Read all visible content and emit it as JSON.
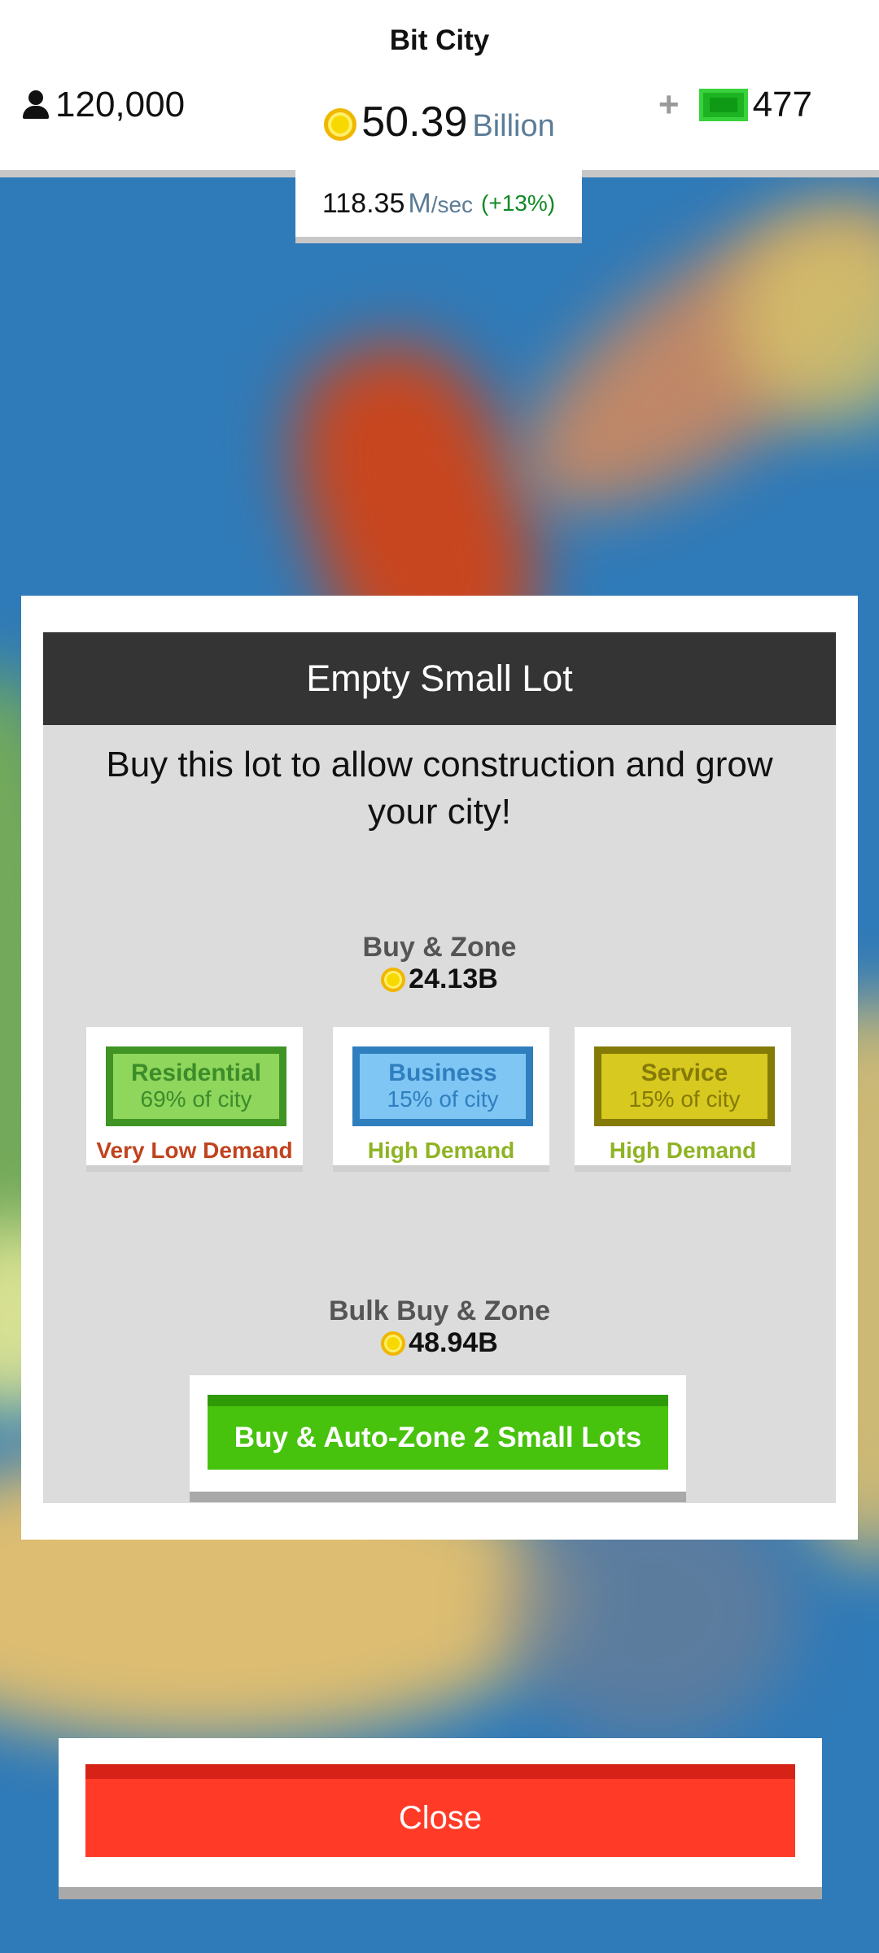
{
  "app": {
    "title": "Bit City"
  },
  "header": {
    "population": "120,000",
    "money_value": "50.39",
    "money_unit": "Billion",
    "rate_value": "118.35",
    "rate_unit": "M",
    "rate_suffix": "/sec",
    "rate_change": "(+13%)",
    "cash_plus": "+",
    "cash": "477"
  },
  "dialog": {
    "title": "Empty Small Lot",
    "description": "Buy this lot to allow construction and grow your city!",
    "buy_zone_label": "Buy & Zone",
    "buy_zone_price": "24.13B",
    "zones": [
      {
        "name": "Residential",
        "share": "69% of city",
        "demand": "Very Low Demand"
      },
      {
        "name": "Business",
        "share": "15% of city",
        "demand": "High Demand"
      },
      {
        "name": "Service",
        "share": "15% of city",
        "demand": "High Demand"
      }
    ],
    "bulk_label": "Bulk Buy & Zone",
    "bulk_price": "48.94B",
    "bulk_button": "Buy & Auto-Zone 2 Small Lots"
  },
  "close_button": "Close",
  "colors": {
    "header_bg": "#ffffff",
    "dialog_title_bg": "#343434",
    "residential": "#8ed65c",
    "business": "#7fc6f5",
    "service": "#d7c91f",
    "low_demand": "#c0431e",
    "high_demand": "#8fb324",
    "buy_button": "#47c20d",
    "close_button": "#ff3b28"
  },
  "icons": [
    "person-icon",
    "coin-icon",
    "cash-bill-icon"
  ]
}
